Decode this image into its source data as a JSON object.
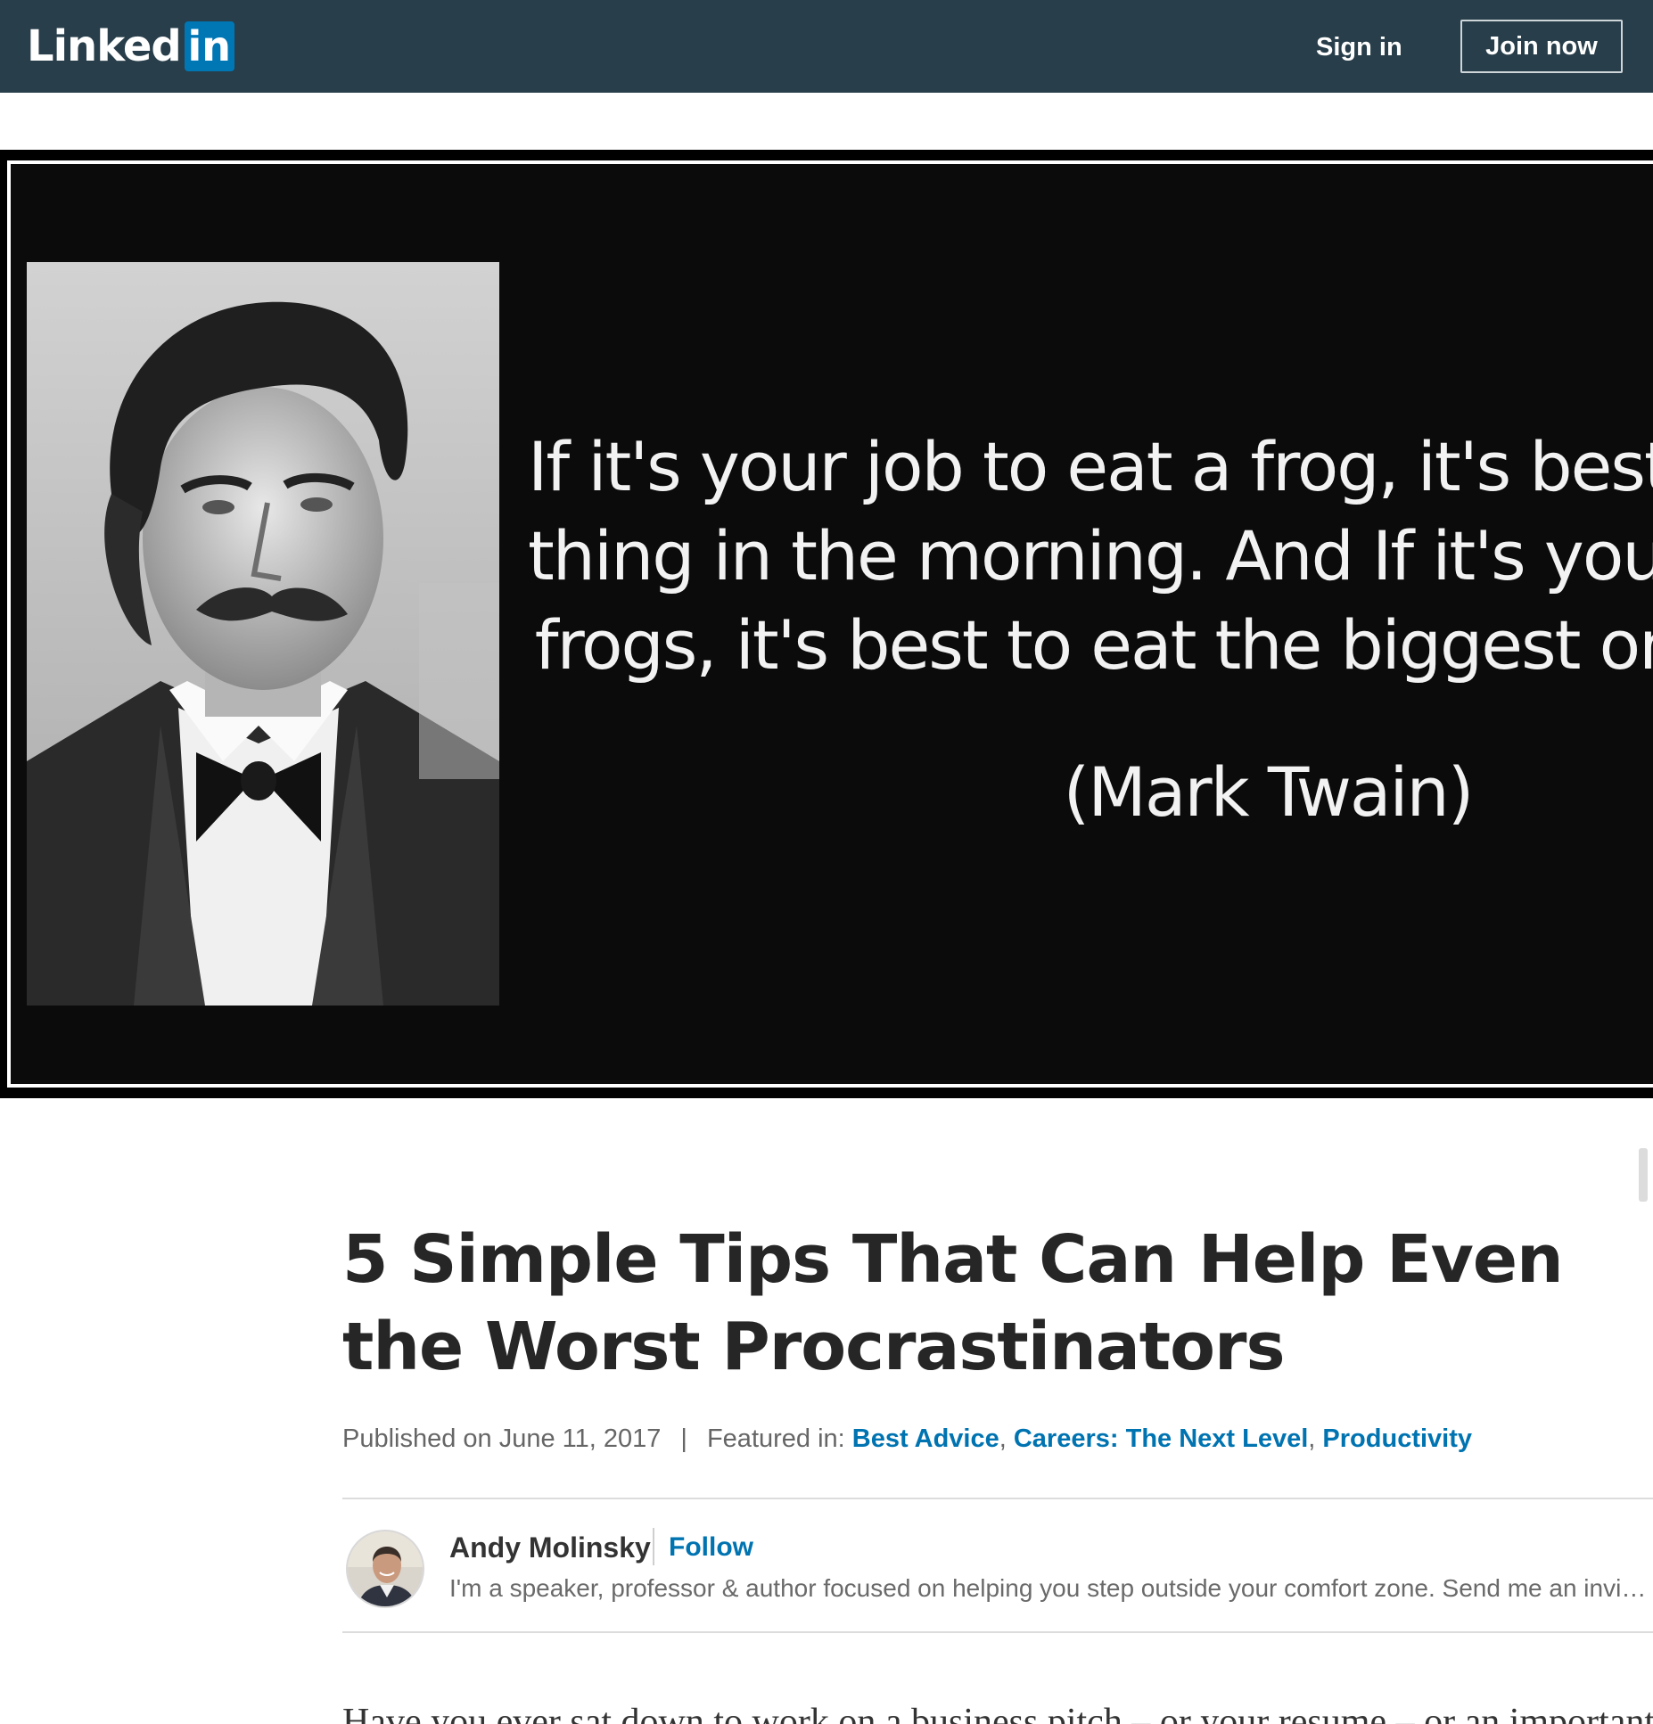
{
  "header": {
    "logo_text": "Linked",
    "logo_box_text": "in",
    "signin_label": "Sign in",
    "join_label": "Join now",
    "background_color": "#283e4a",
    "brand_blue": "#0077b5"
  },
  "hero": {
    "quote": "If it's your job to eat a frog, it's best to\nthing in the morning. And If it's your job\nfrogs, it's best to eat the biggest on",
    "attribution": "(Mark Twain)"
  },
  "article": {
    "title": "5 Simple Tips That Can Help Even the Worst Procrastinators",
    "published": "Published on June 11, 2017",
    "separator": "|",
    "featured_label": "Featured in:",
    "featured": [
      "Best Advice",
      "Careers: The Next Level",
      "Productivity"
    ],
    "link_color": "#0073b1",
    "body_start": "Have you ever sat down to work on a business pitch – or your resume – or an important"
  },
  "author": {
    "name": "Andy Molinsky",
    "follow_label": "Follow",
    "bio": "I'm a speaker, professor & author focused on helping you step outside your comfort zone. Send me an invi…"
  }
}
